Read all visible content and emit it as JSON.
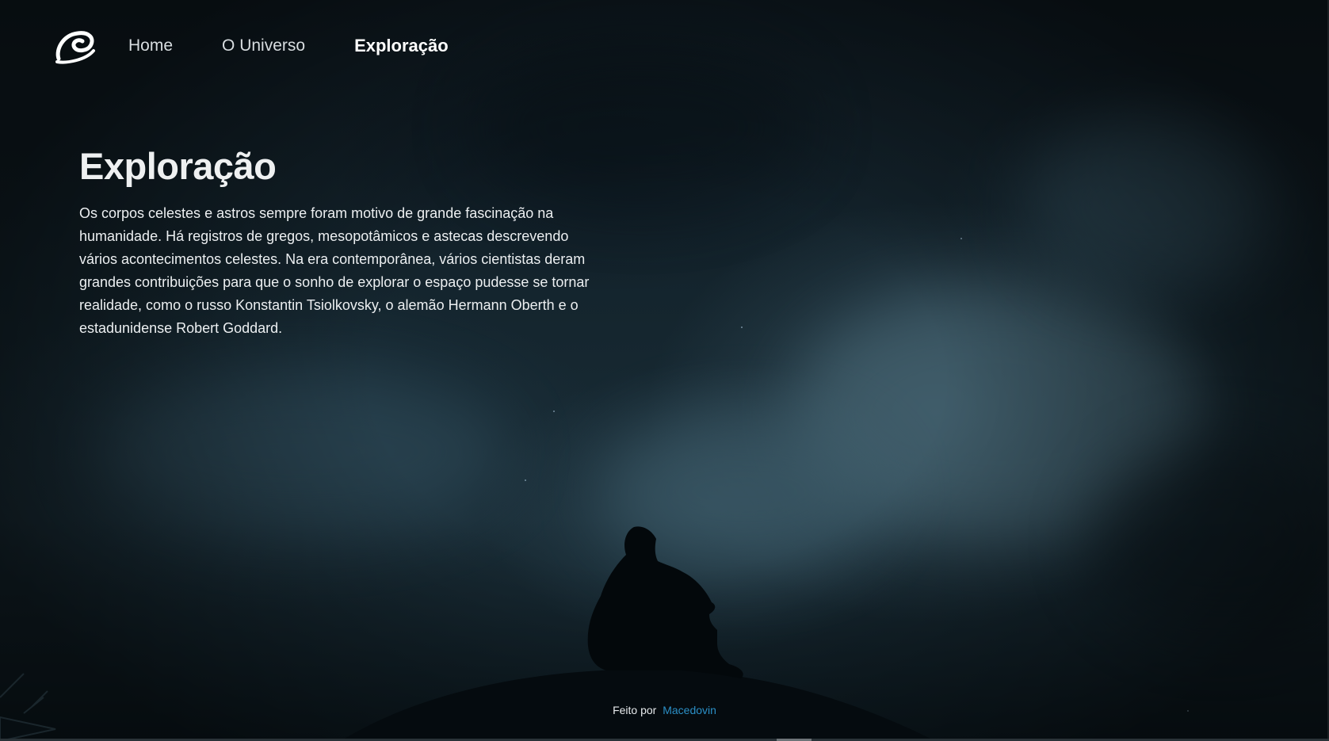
{
  "nav": {
    "logo_icon": "swirl-galaxy-logo-icon",
    "links": [
      {
        "label": "Home",
        "active": false
      },
      {
        "label": "O Universo",
        "active": false
      },
      {
        "label": "Exploração",
        "active": true
      }
    ]
  },
  "main": {
    "title": "Exploração",
    "paragraph": "Os corpos celestes e astros sempre foram motivo de grande fascinação na humanidade. Há registros de gregos, mesopotâmicos e astecas descrevendo vários acontecimentos celestes. Na era contemporânea, vários cientistas deram grandes contribuições para que o sonho de explorar o espaço pudesse se tornar realidade, como o russo Konstantin Tsiolkovsky, o alemão Hermann Oberth e o estadunidense Robert Goddard."
  },
  "footer": {
    "made_by_label": "Feito por",
    "author": "Macedovin"
  },
  "colors": {
    "background": "#15262f",
    "text": "#eceff1",
    "link_accent": "#2b8fc6"
  }
}
